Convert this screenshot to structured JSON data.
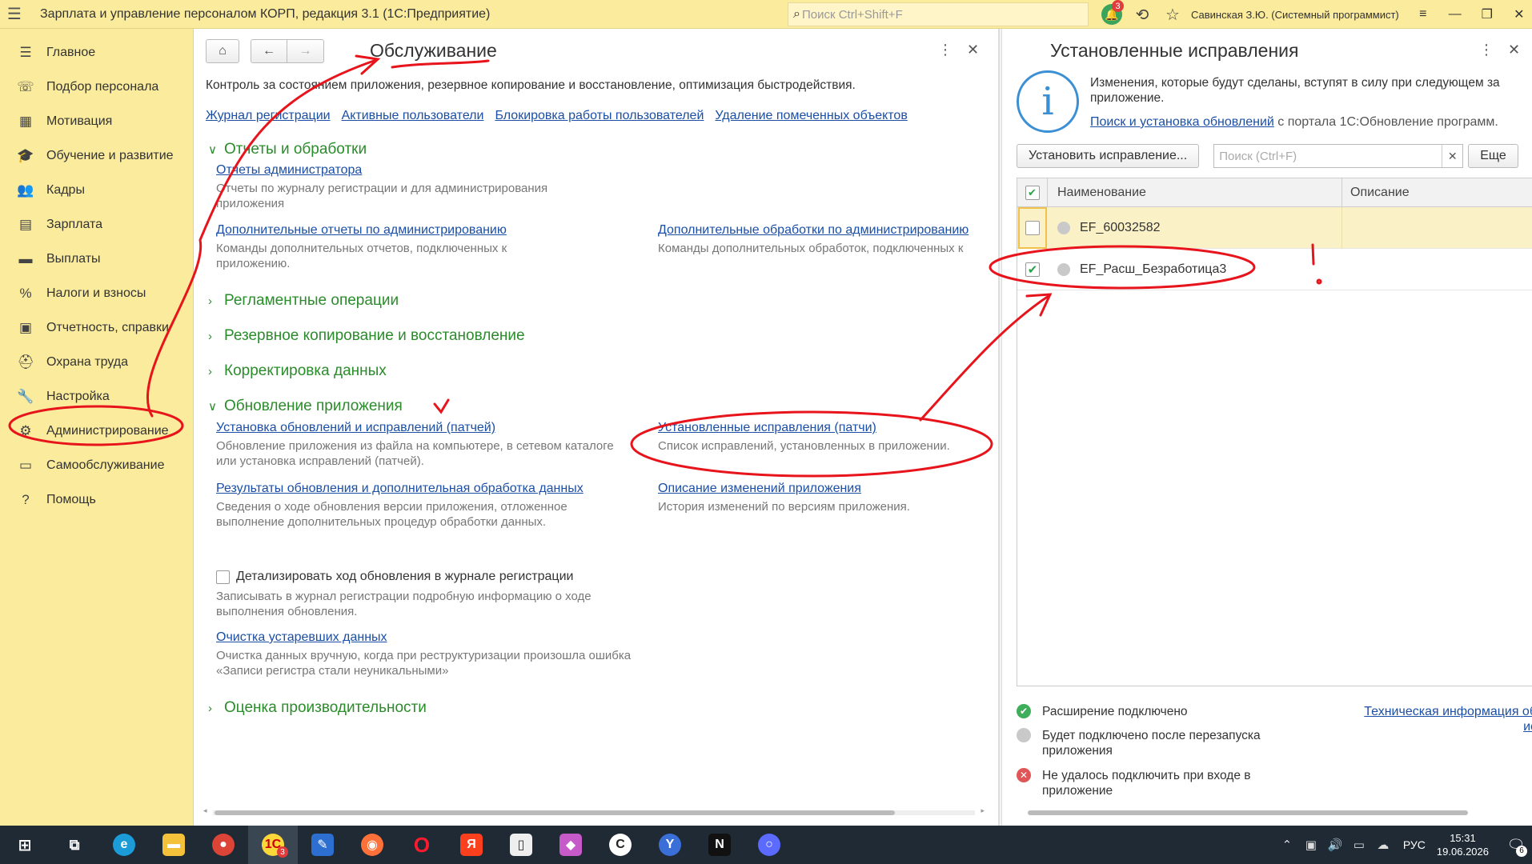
{
  "titlebar": {
    "app_title": "Зарплата и управление персоналом КОРП, редакция 3.1  (1С:Предприятие)",
    "search_placeholder": "Поиск Ctrl+Shift+F",
    "notifications_count": "3",
    "user": "Савинская З.Ю. (Системный программист)"
  },
  "sidebar": {
    "items": [
      {
        "label": "Главное",
        "icon": "menu-lines-icon"
      },
      {
        "label": "Подбор персонала",
        "icon": "recruit-icon"
      },
      {
        "label": "Мотивация",
        "icon": "motivation-icon"
      },
      {
        "label": "Обучение и развитие",
        "icon": "education-icon"
      },
      {
        "label": "Кадры",
        "icon": "people-icon"
      },
      {
        "label": "Зарплата",
        "icon": "calculator-icon"
      },
      {
        "label": "Выплаты",
        "icon": "payment-icon"
      },
      {
        "label": "Налоги и взносы",
        "icon": "percent-icon"
      },
      {
        "label": "Отчетность, справки",
        "icon": "report-icon"
      },
      {
        "label": "Охрана труда",
        "icon": "helmet-icon"
      },
      {
        "label": "Настройка",
        "icon": "wrench-icon"
      },
      {
        "label": "Администрирование",
        "icon": "gear-icon"
      },
      {
        "label": "Самообслуживание",
        "icon": "card-icon"
      },
      {
        "label": "Помощь",
        "icon": "question-icon"
      }
    ]
  },
  "main": {
    "title": "Обслуживание",
    "subtitle": "Контроль за состоянием приложения, резервное копирование и восстановление, оптимизация быстродействия.",
    "top_links": [
      "Журнал регистрации",
      "Активные пользователи",
      "Блокировка работы пользователей",
      "Удаление помеченных объектов"
    ],
    "sections": {
      "reports": "Отчеты и обработки",
      "routine": "Регламентные операции",
      "backup": "Резервное копирование и восстановление",
      "correction": "Корректировка данных",
      "update": "Обновление приложения",
      "performance": "Оценка производительности"
    },
    "reports_items": {
      "admin_reports": {
        "link": "Отчеты администратора",
        "desc": "Отчеты по журналу регистрации и для администрирования приложения"
      },
      "extra_reports": {
        "link": "Дополнительные отчеты по администрированию",
        "desc": "Команды дополнительных отчетов, подключенных к приложению."
      },
      "extra_processing": {
        "link": "Дополнительные обработки по администрированию",
        "desc": "Команды дополнительных обработок, подключенных к"
      }
    },
    "update_items": {
      "install": {
        "link": "Установка обновлений и исправлений (патчей)",
        "desc": "Обновление приложения из файла на компьютере, в сетевом каталоге или установка исправлений (патчей)."
      },
      "installed_patches": {
        "link": "Установленные исправления (патчи)",
        "desc": "Список исправлений, установленных в приложении."
      },
      "results": {
        "link": "Результаты обновления и дополнительная обработка данных",
        "desc": "Сведения о ходе обновления версии приложения, отложенное выполнение дополнительных процедур обработки данных."
      },
      "changes": {
        "link": "Описание изменений приложения",
        "desc": "История изменений по версиям приложения."
      },
      "detail_checkbox": "Детализировать ход обновления в журнале регистрации",
      "detail_desc": "Записывать в журнал регистрации подробную информацию о ходе выполнения обновления.",
      "cleanup": {
        "link": "Очистка устаревших данных",
        "desc": "Очистка данных вручную, когда при реструктуризации произошла ошибка «Записи регистра стали неуникальными»"
      }
    }
  },
  "right": {
    "title": "Установленные исправления",
    "info_text": "Изменения, которые будут сделаны, вступят в силу при следующем за приложение.",
    "info_link": "Поиск и установка обновлений",
    "info_link_suffix": " с портала 1С:Обновление программ.",
    "install_button": "Установить исправление...",
    "search_placeholder": "Поиск (Ctrl+F)",
    "more_button": "Еще",
    "columns": [
      "Наименование",
      "Описание"
    ],
    "rows": [
      {
        "name": "EF_60032582",
        "checked": false,
        "selected": true
      },
      {
        "name": "EF_Расш_Безработица3",
        "checked": true,
        "selected": false
      }
    ],
    "legend": [
      {
        "text": "Расширение подключено",
        "color": "#3fae5a"
      },
      {
        "text": "Будет подключено после перезапуска приложения",
        "color": "#c9c9c9"
      },
      {
        "text": "Не удалось подключить при входе в приложение",
        "color": "#e05555"
      }
    ],
    "tech_link": "Техническая информация об ис"
  },
  "taskbar": {
    "apps": [
      {
        "name": "windows-start-icon"
      },
      {
        "name": "task-view-icon"
      },
      {
        "name": "edge-icon"
      },
      {
        "name": "explorer-icon"
      },
      {
        "name": "chrome-icon"
      },
      {
        "name": "1c-icon",
        "badge": "3"
      },
      {
        "name": "editor-icon"
      },
      {
        "name": "firefox-icon"
      },
      {
        "name": "opera-icon"
      },
      {
        "name": "yandex-icon"
      },
      {
        "name": "document-icon"
      },
      {
        "name": "gem-app-icon"
      },
      {
        "name": "c-app-icon"
      },
      {
        "name": "y-app-icon"
      },
      {
        "name": "n-app-icon"
      },
      {
        "name": "chat-app-icon"
      }
    ],
    "lang": "РУС",
    "time": "15:31",
    "date": "19.06.2026",
    "notif_count": "6"
  }
}
